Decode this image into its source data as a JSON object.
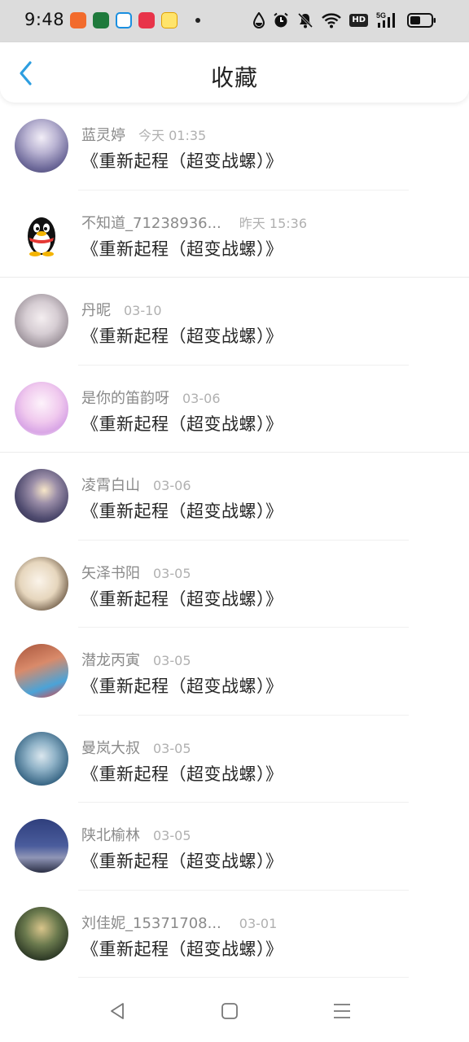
{
  "status_bar": {
    "time": "9:48",
    "notification_icons": [
      "app-icon-orange",
      "app-icon-green",
      "app-icon-blue",
      "app-icon-red",
      "app-icon-yellow"
    ],
    "system_icons": [
      "drop-icon",
      "alarm-icon",
      "mute-icon",
      "wifi-icon",
      "hd-badge",
      "signal-icon",
      "battery-icon"
    ],
    "hd_label": "HD",
    "network_label": "5G"
  },
  "header": {
    "title": "收藏",
    "back_icon": "chevron-left-icon"
  },
  "items": [
    {
      "name": "蓝灵婷",
      "time": "今天 01:35",
      "title": "《重新起程（超变战螺）》",
      "avatar_color": "#8f8fb8"
    },
    {
      "name": "不知道_71238936...",
      "time": "昨天 15:36",
      "title": "《重新起程（超变战螺）》",
      "avatar_color": "#111111"
    },
    {
      "name": "丹昵",
      "time": "03-10",
      "title": "《重新起程（超变战螺）》",
      "avatar_color": "#b9b0b6"
    },
    {
      "name": "是你的笛韵呀",
      "time": "03-06",
      "title": "《重新起程（超变战螺）》",
      "avatar_color": "#e7b9e6"
    },
    {
      "name": "凌霄白山",
      "time": "03-06",
      "title": "《重新起程（超变战螺）》",
      "avatar_color": "#4b4a6a"
    },
    {
      "name": "矢泽书阳",
      "time": "03-05",
      "title": "《重新起程（超变战螺）》",
      "avatar_color": "#d9c7a9"
    },
    {
      "name": "潜龙丙寅",
      "time": "03-05",
      "title": "《重新起程（超变战螺）》",
      "avatar_color": "#c96a4e"
    },
    {
      "name": "曼岚大叔",
      "time": "03-05",
      "title": "《重新起程（超变战螺）》",
      "avatar_color": "#4a7a98"
    },
    {
      "name": "陕北榆林",
      "time": "03-05",
      "title": "《重新起程（超变战螺）》",
      "avatar_color": "#3f4f86"
    },
    {
      "name": "刘佳妮_15371708...",
      "time": "03-01",
      "title": "《重新起程（超变战螺）》",
      "avatar_color": "#3b4a33"
    }
  ],
  "nav_bar": {
    "buttons": [
      "back-triangle-icon",
      "home-square-icon",
      "menu-lines-icon"
    ]
  },
  "colors": {
    "accent": "#2d9ee0",
    "status_bar_bg": "#dcdcdc",
    "name_text": "#8a8a8a",
    "time_text": "#b0b0b0",
    "title_text": "#262626"
  }
}
